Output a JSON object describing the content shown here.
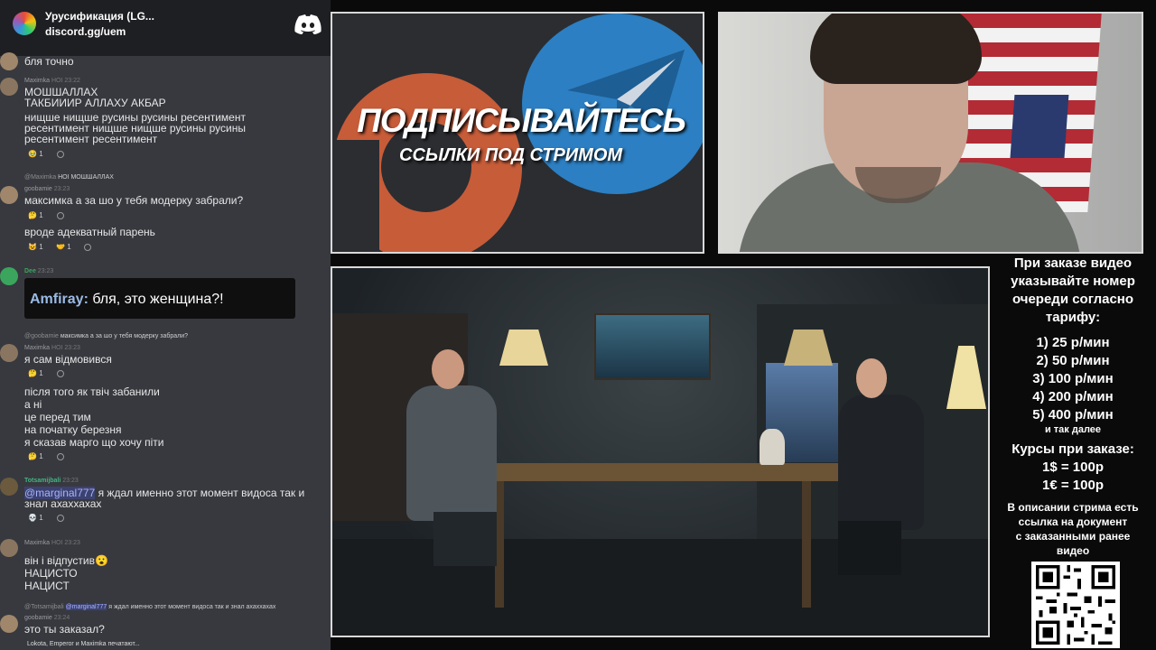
{
  "chat": {
    "server_name": "Урусификация (LG...",
    "server_invite": "discord.gg/uem",
    "messages": [
      {
        "author": "",
        "lines": [
          "бля точно"
        ]
      },
      {
        "author": "Maximka",
        "badge": "HOI",
        "time": "23:22",
        "lines": [
          "МОШШАЛЛАХ",
          "ТАКБИИИР АЛЛАХУ АКБАР",
          "нищше нищше русины русины ресентимент",
          "ресентимент нищше нищше русины русины",
          "ресентимент ресентимент"
        ],
        "reactions": [
          {
            "emoji": "🥹",
            "count": "1"
          }
        ]
      },
      {
        "author": "goobamie",
        "time": "23:23",
        "reply": {
          "author": "@Maximka",
          "badge": "HOI",
          "text": "МОШШАЛЛАХ"
        },
        "lines": [
          "максимка а за шо у тебя модерку забрали?"
        ],
        "reactions": [
          {
            "emoji": "🤔",
            "count": "1"
          }
        ],
        "lines2": [
          "вроде адекватный парень"
        ],
        "reactions2": [
          {
            "emoji": "😺",
            "count": "1"
          },
          {
            "emoji": "🤝",
            "count": "1"
          }
        ]
      },
      {
        "author": "Dee",
        "time": "23:23",
        "highlight": {
          "name": "Amfiray:",
          "text": "бля, это женщина?!"
        }
      },
      {
        "author": "Maximka",
        "badge": "HOI",
        "time": "23:23",
        "reply": {
          "author": "@goobamie",
          "text": "максимка а за шо у тебя модерку забрали?"
        },
        "lines": [
          "я сам відмовився"
        ],
        "reactions": [
          {
            "emoji": "🤔",
            "count": "1"
          }
        ],
        "lines2": [
          "після того як твіч забанили",
          "а ні",
          "це перед тим",
          "на початку березня",
          "я сказав марго що хочу піти"
        ],
        "reactions2": [
          {
            "emoji": "🤔",
            "count": "1"
          }
        ]
      },
      {
        "author": "Totsamijbali",
        "time": "23:23",
        "mention": "@marginal777",
        "lines": [
          "я ждал именно этот момент видоса так и",
          "знал ахаххахах"
        ],
        "reactions": [
          {
            "emoji": "💀",
            "count": "1"
          }
        ]
      },
      {
        "author": "Maximka",
        "badge": "HOI",
        "time": "23:23",
        "lines": [
          "він і відпустив😮",
          "НАЦИСТО",
          "НАЦИСТ"
        ]
      },
      {
        "author": "goobamie",
        "time": "23:24",
        "reply": {
          "author": "@Totsamijbali",
          "mention": "@marginal777",
          "text": "я ждал именно этот момент видоса так и знал ахаххахах"
        },
        "lines": [
          "это ты заказал?"
        ]
      }
    ],
    "typing": "Lokota, Emperor и Maximka печатают..."
  },
  "promo": {
    "title": "ПОДПИСЫВАЙТЕСЬ",
    "subtitle": "ССЫЛКИ ПОД СТРИМОМ"
  },
  "info": {
    "heading": [
      "При заказе видео",
      "указывайте номер",
      "очереди согласно",
      "тарифу:"
    ],
    "tariffs": [
      "1) 25 р/мин",
      "2) 50 р/мин",
      "3) 100 р/мин",
      "4) 200 р/мин",
      "5) 400 р/мин"
    ],
    "and_more": "и так далее",
    "rates_heading": "Курсы при заказе:",
    "rates": [
      "1$ = 100р",
      "1€ = 100р"
    ],
    "description": [
      "В описании стрима есть",
      "ссылка на документ",
      "с заказанными ранее",
      "видео"
    ]
  },
  "colors": {
    "chat_bg": "#37393f",
    "header_bg": "#1e1f22",
    "patreon": "#c75c39",
    "telegram": "#2c7fc2"
  }
}
